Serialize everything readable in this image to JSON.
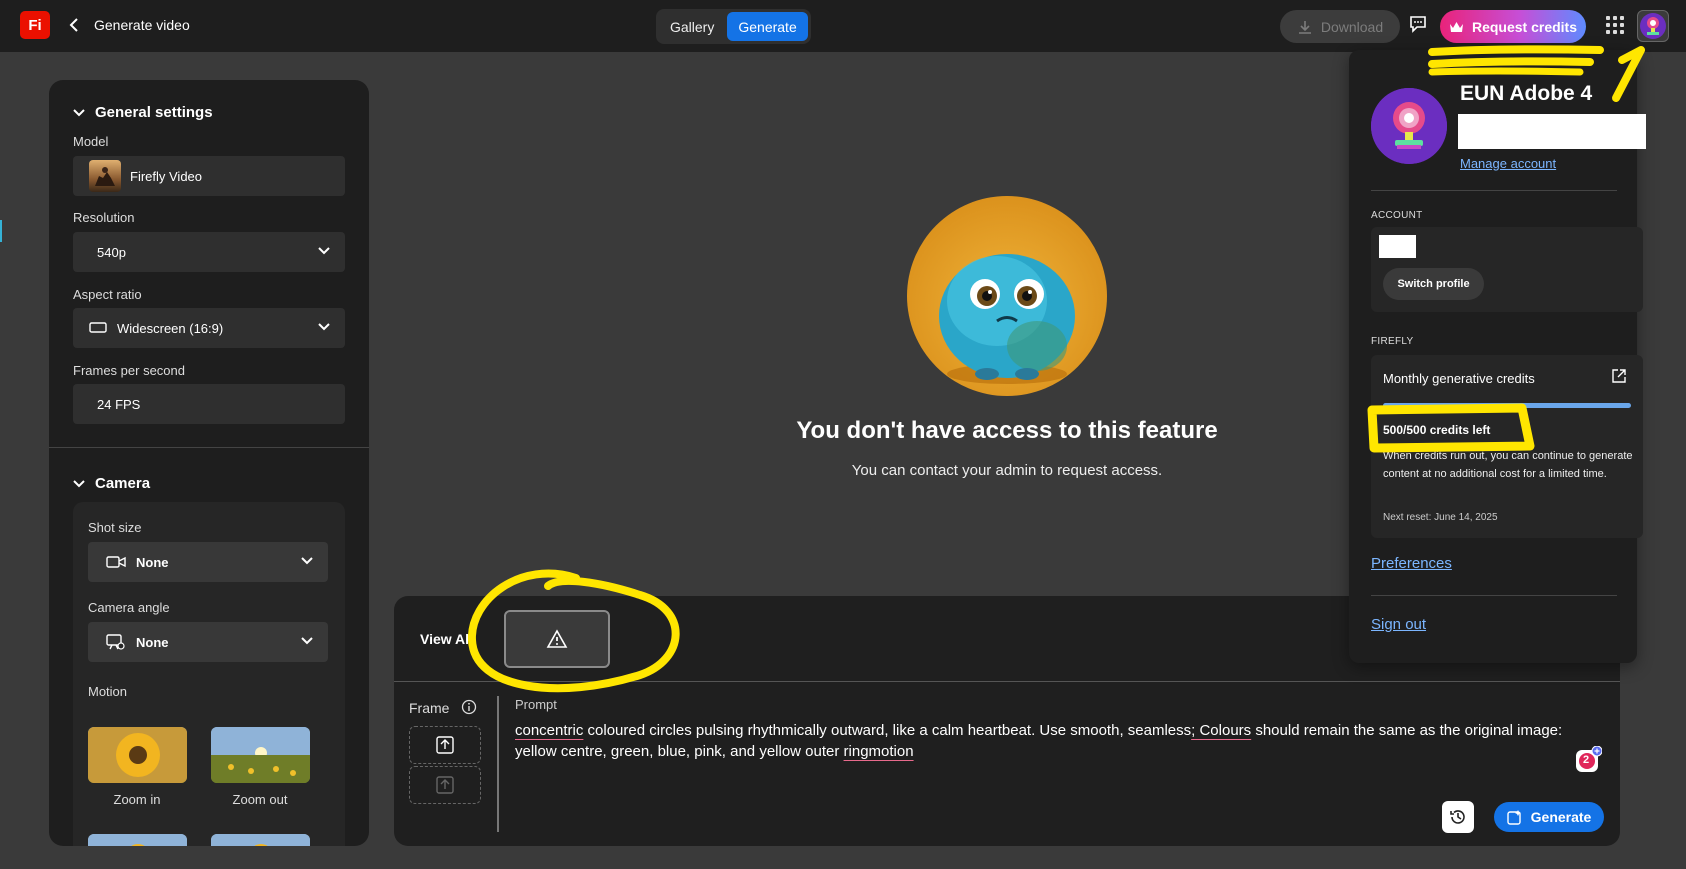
{
  "header": {
    "logo": "Fi",
    "page_title": "Generate video",
    "tabs": [
      "Gallery",
      "Generate"
    ],
    "download_label": "Download",
    "request_credits_label": "Request credits"
  },
  "left_panel": {
    "general_settings": {
      "title": "General settings",
      "model_label": "Model",
      "model_value": "Firefly Video",
      "resolution_label": "Resolution",
      "resolution_value": "540p",
      "aspect_label": "Aspect ratio",
      "aspect_value": "Widescreen (16:9)",
      "fps_label": "Frames per second",
      "fps_value": "24 FPS"
    },
    "camera": {
      "title": "Camera",
      "shot_size_label": "Shot size",
      "shot_size_value": "None",
      "angle_label": "Camera angle",
      "angle_value": "None",
      "motion_label": "Motion",
      "motion_options": [
        "Zoom in",
        "Zoom out"
      ]
    }
  },
  "main": {
    "no_access_title": "You don't have access to this feature",
    "no_access_sub": "You can contact your admin to request access."
  },
  "prompt_panel": {
    "view_all": "View All",
    "frame_label": "Frame",
    "prompt_label": "Prompt",
    "prompt_words": {
      "w1": "concentric",
      "w2": " coloured circles pulsing rhythmically outward, like a calm heartbeat. Use smooth, seamless",
      "w3": "; Colours",
      "w4": " should remain the same as the original image: yellow centre, green, blue, pink, and yellow outer ",
      "w5": "ringmotion"
    },
    "badge_count": "2",
    "generate_label": "Generate"
  },
  "account_popover": {
    "name": "EUN Adobe 4",
    "manage_account": "Manage account",
    "account_section": "ACCOUNT",
    "switch_profile": "Switch profile",
    "firefly_section": "FIREFLY",
    "credits_title": "Monthly generative credits",
    "credits_left": "500/500 credits left",
    "credits_fraction": 1.0,
    "credits_note": "When credits run out, you can continue to generate content at no additional cost for a limited time.",
    "next_reset": "Next reset: June 14, 2025",
    "preferences": "Preferences",
    "sign_out": "Sign out"
  },
  "annotations": {
    "marker_digit": "1",
    "marker_color": "#ffe600"
  }
}
